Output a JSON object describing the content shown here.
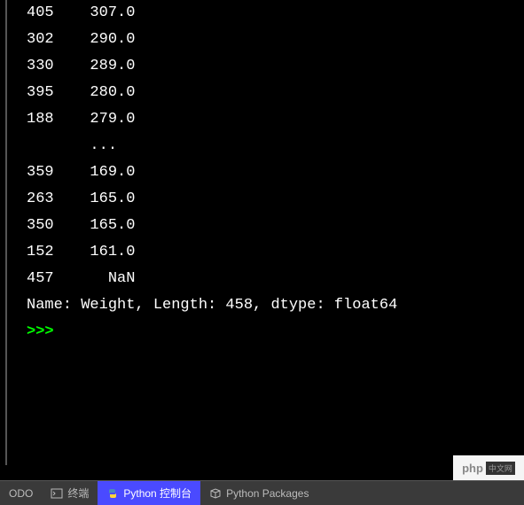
{
  "console": {
    "rows_top": [
      {
        "index": "405",
        "value": "307.0"
      },
      {
        "index": "302",
        "value": "290.0"
      },
      {
        "index": "330",
        "value": "289.0"
      },
      {
        "index": "395",
        "value": "280.0"
      },
      {
        "index": "188",
        "value": "279.0"
      }
    ],
    "ellipsis": "...",
    "rows_bottom": [
      {
        "index": "359",
        "value": "169.0"
      },
      {
        "index": "263",
        "value": "165.0"
      },
      {
        "index": "350",
        "value": "165.0"
      },
      {
        "index": "152",
        "value": "161.0"
      },
      {
        "index": "457",
        "value": "NaN"
      }
    ],
    "summary": "Name: Weight, Length: 458, dtype: float64",
    "prompt": ">>> "
  },
  "tabs": {
    "todo": "ODO",
    "terminal": "终端",
    "python_console": "Python 控制台",
    "python_packages": "Python Packages"
  },
  "watermark": {
    "text": "php",
    "badge": "中文网"
  }
}
